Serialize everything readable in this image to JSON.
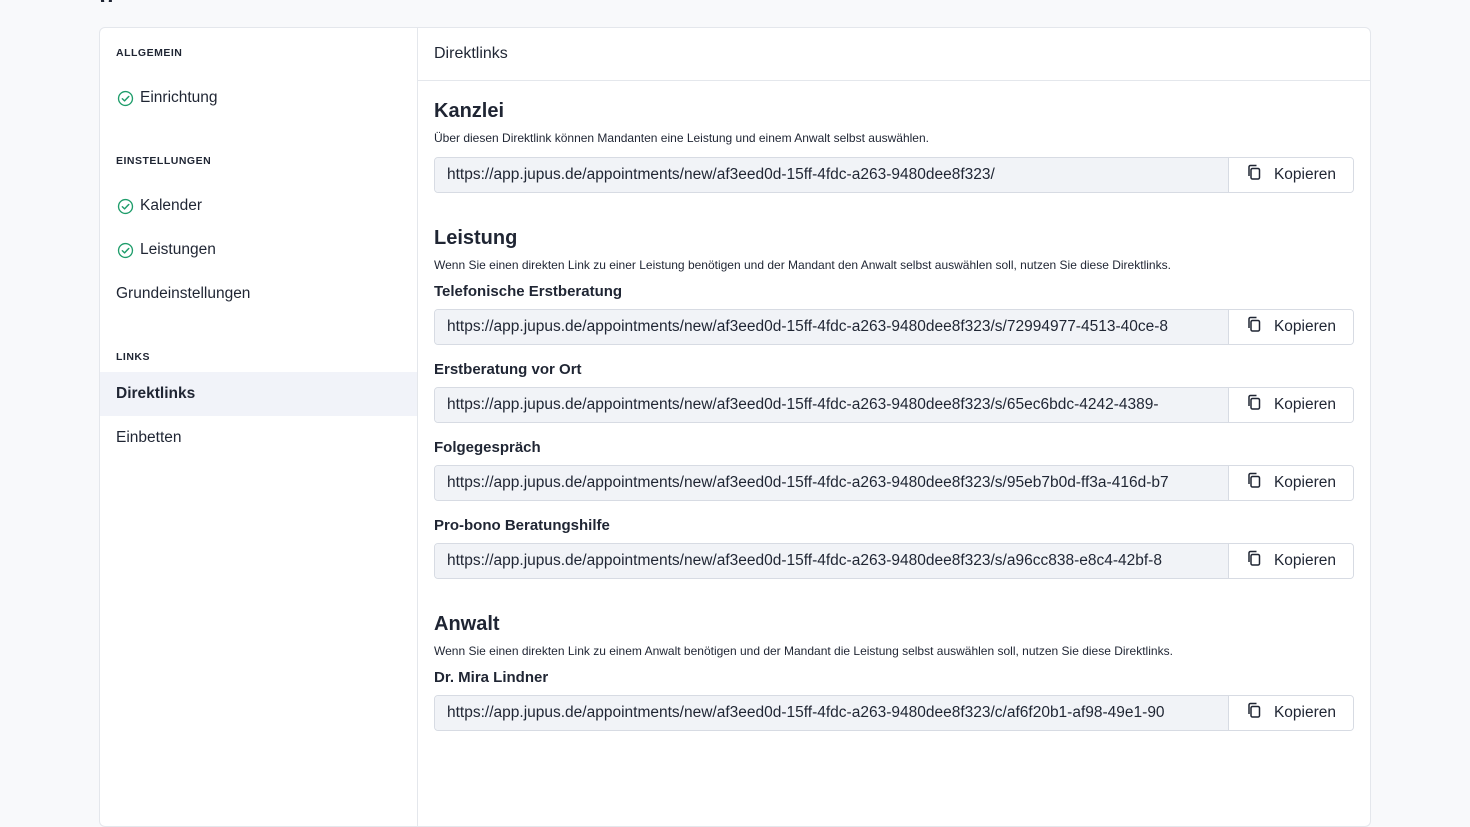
{
  "page": {
    "heading_partial": "g"
  },
  "sidebar": {
    "sections": [
      {
        "label": "ALLGEMEIN",
        "items": [
          {
            "label": "Einrichtung",
            "icon": "check-circle-icon",
            "done": true
          }
        ]
      },
      {
        "label": "EINSTELLUNGEN",
        "items": [
          {
            "label": "Kalender",
            "icon": "check-circle-icon",
            "done": true
          },
          {
            "label": "Leistungen",
            "icon": "check-circle-icon",
            "done": true
          },
          {
            "label": "Grundeinstellungen",
            "done": false
          }
        ]
      },
      {
        "label": "LINKS",
        "items": [
          {
            "label": "Direktlinks",
            "active": true
          },
          {
            "label": "Einbetten"
          }
        ]
      }
    ]
  },
  "main": {
    "header": "Direktlinks",
    "copy_label": "Kopieren",
    "kanzlei": {
      "title": "Kanzlei",
      "description": "Über diesen Direktlink können Mandanten eine Leistung und einem Anwalt selbst auswählen.",
      "url": "https://app.jupus.de/appointments/new/af3eed0d-15ff-4fdc-a263-9480dee8f323/"
    },
    "leistung": {
      "title": "Leistung",
      "description": "Wenn Sie einen direkten Link zu einer Leistung benötigen und der Mandant den Anwalt selbst auswählen soll, nutzen Sie diese Direktlinks.",
      "items": [
        {
          "label": "Telefonische Erstberatung",
          "url": "https://app.jupus.de/appointments/new/af3eed0d-15ff-4fdc-a263-9480dee8f323/s/72994977-4513-40ce-8"
        },
        {
          "label": "Erstberatung vor Ort",
          "url": "https://app.jupus.de/appointments/new/af3eed0d-15ff-4fdc-a263-9480dee8f323/s/65ec6bdc-4242-4389-"
        },
        {
          "label": "Folgegespräch",
          "url": "https://app.jupus.de/appointments/new/af3eed0d-15ff-4fdc-a263-9480dee8f323/s/95eb7b0d-ff3a-416d-b7"
        },
        {
          "label": "Pro-bono Beratungshilfe",
          "url": "https://app.jupus.de/appointments/new/af3eed0d-15ff-4fdc-a263-9480dee8f323/s/a96cc838-e8c4-42bf-8"
        }
      ]
    },
    "anwalt": {
      "title": "Anwalt",
      "description": "Wenn Sie einen direkten Link zu einem Anwalt benötigen und der Mandant die Leistung selbst auswählen soll, nutzen Sie diese Direktlinks.",
      "items": [
        {
          "label": "Dr. Mira Lindner",
          "url": "https://app.jupus.de/appointments/new/af3eed0d-15ff-4fdc-a263-9480dee8f323/c/af6f20b1-af98-49e1-90"
        }
      ]
    }
  },
  "colors": {
    "check": "#1f9d6b",
    "active_bg": "#f1f3f9",
    "input_bg": "#f1f3f7",
    "border": "#d7dbe3"
  }
}
